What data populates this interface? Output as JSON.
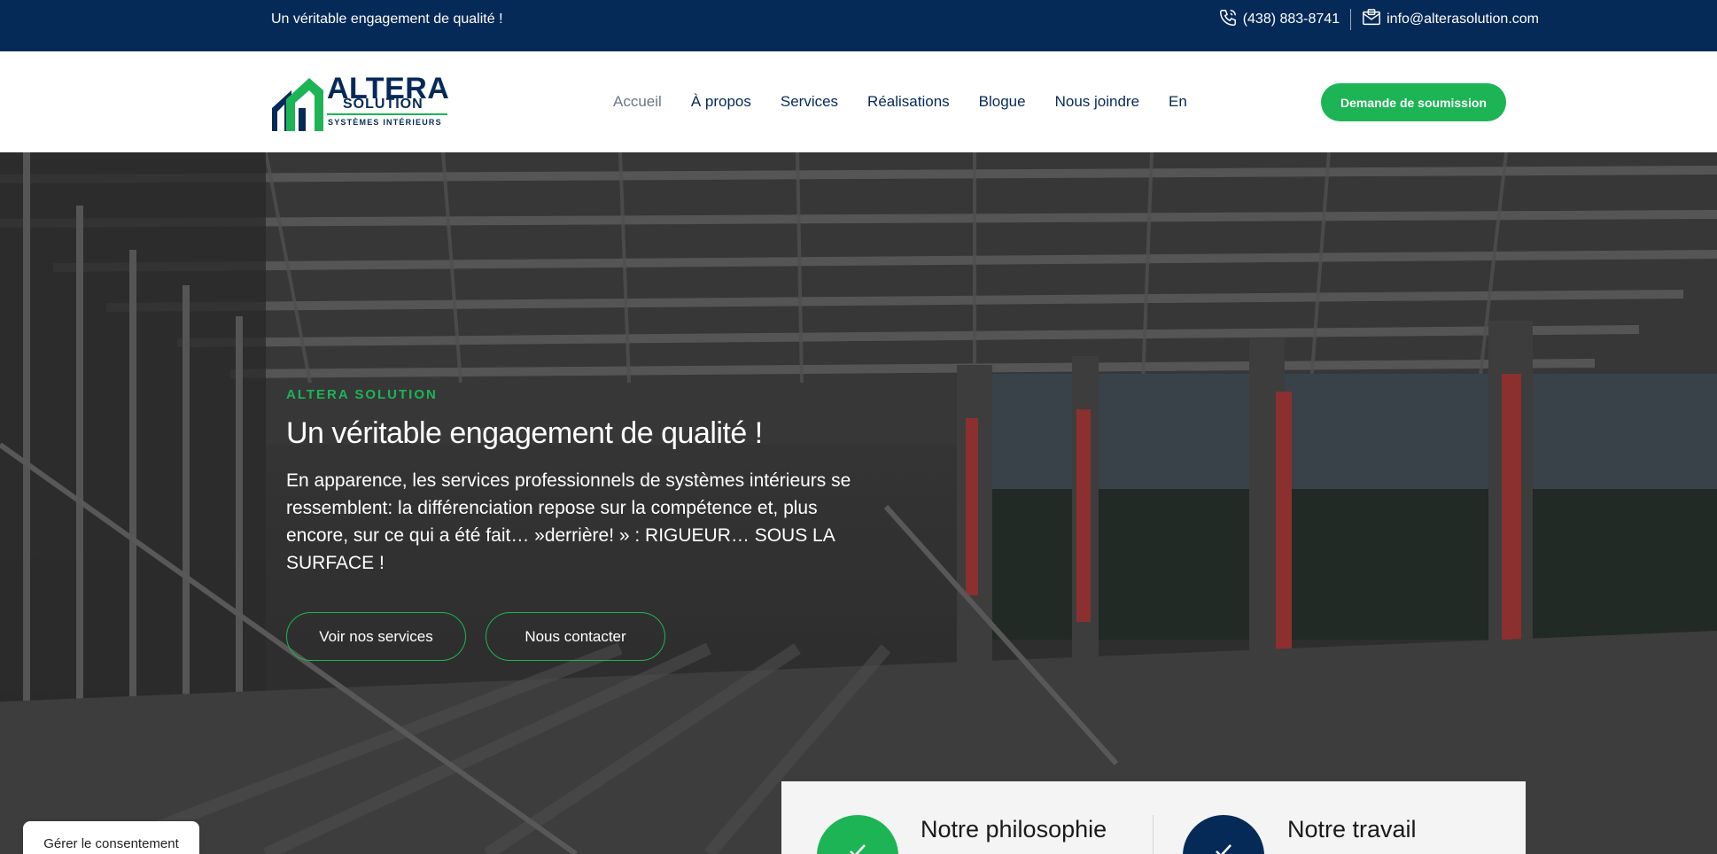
{
  "topbar": {
    "tagline": "Un véritable engagement de qualité !",
    "phone": "(438) 883-8741",
    "email": "info@alterasolution.com"
  },
  "logo": {
    "name": "ALTERA",
    "sub": "SOLUTION",
    "tagline": "SYSTÈMES INTÉRIEURS"
  },
  "nav": {
    "items": [
      {
        "label": "Accueil",
        "active": true
      },
      {
        "label": "À propos"
      },
      {
        "label": "Services"
      },
      {
        "label": "Réalisations"
      },
      {
        "label": "Blogue"
      },
      {
        "label": "Nous joindre"
      },
      {
        "label": "En"
      }
    ]
  },
  "header": {
    "cta_label": "Demande de soumission"
  },
  "hero": {
    "eyebrow": "ALTERA SOLUTION",
    "title": "Un véritable engagement de qualité !",
    "text": "En apparence, les services professionnels de systèmes intérieurs se ressemblent: la différenciation repose sur la compétence et, plus encore, sur ce qui a été fait… »derrière! » : RIGUEUR… SOUS LA SURFACE !",
    "btn_services": "Voir nos services",
    "btn_contact": "Nous contacter"
  },
  "info": {
    "col1_title": "Notre philosophie",
    "col2_title": "Notre travail"
  },
  "consent": {
    "label": "Gérer le consentement"
  },
  "colors": {
    "navy": "#062a58",
    "green": "#1db456"
  }
}
